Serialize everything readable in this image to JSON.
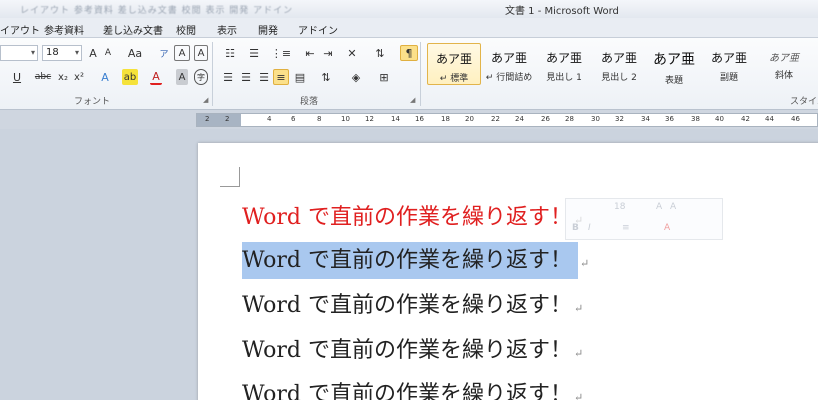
{
  "window": {
    "title": "文書 1 - Microsoft Word",
    "blurred_tabs": "レイアウト  参考資料  差し込み文書  校閲  表示  開発  アドイン"
  },
  "tabs": [
    "イアウト",
    "参考資料",
    "差し込み文書",
    "校閲",
    "表示",
    "開発",
    "アドイン"
  ],
  "font_group": {
    "label": "フォント",
    "font_size": "18",
    "buttons": [
      "A",
      "A",
      "Aa",
      "U",
      "abc",
      "x₂",
      "x²",
      "A",
      "ab",
      "A",
      "A",
      "字"
    ]
  },
  "paragraph_group": {
    "label": "段落",
    "buttons": [
      "☰",
      "☰",
      "☰",
      "≡",
      "⇅",
      "A↕",
      "¶"
    ]
  },
  "styles_group": {
    "label": "スタイル",
    "styles": [
      {
        "sample": "あア亜",
        "name": "↵ 標準"
      },
      {
        "sample": "あア亜",
        "name": "↵ 行間詰め"
      },
      {
        "sample": "あア亜",
        "name": "見出し 1"
      },
      {
        "sample": "あア亜",
        "name": "見出し 2"
      },
      {
        "sample": "あア亜",
        "name": "表題"
      },
      {
        "sample": "あア亜",
        "name": "副題"
      },
      {
        "sample": "あア亜",
        "name": "斜体"
      }
    ]
  },
  "ruler": {
    "numbers": [
      "2",
      "2",
      "4",
      "6",
      "8",
      "10",
      "12",
      "14",
      "16",
      "18",
      "20",
      "22",
      "24",
      "26",
      "28",
      "30",
      "32",
      "34",
      "36",
      "38",
      "40",
      "42",
      "44",
      "46"
    ]
  },
  "document": {
    "lines": [
      "Word で直前の作業を繰り返す！",
      "Word で直前の作業を繰り返す！",
      "Word で直前の作業を繰り返す！",
      "Word で直前の作業を繰り返す！",
      "Word で直前の作業を繰り返す！"
    ],
    "paragraph_mark": "↵",
    "colors": {
      "first_line": "#e02020",
      "selection": "#a9c8ef"
    }
  },
  "mini_toolbar": {
    "font_size": "18",
    "items": [
      "A",
      "A",
      "B",
      "I",
      "≡",
      "A"
    ]
  }
}
